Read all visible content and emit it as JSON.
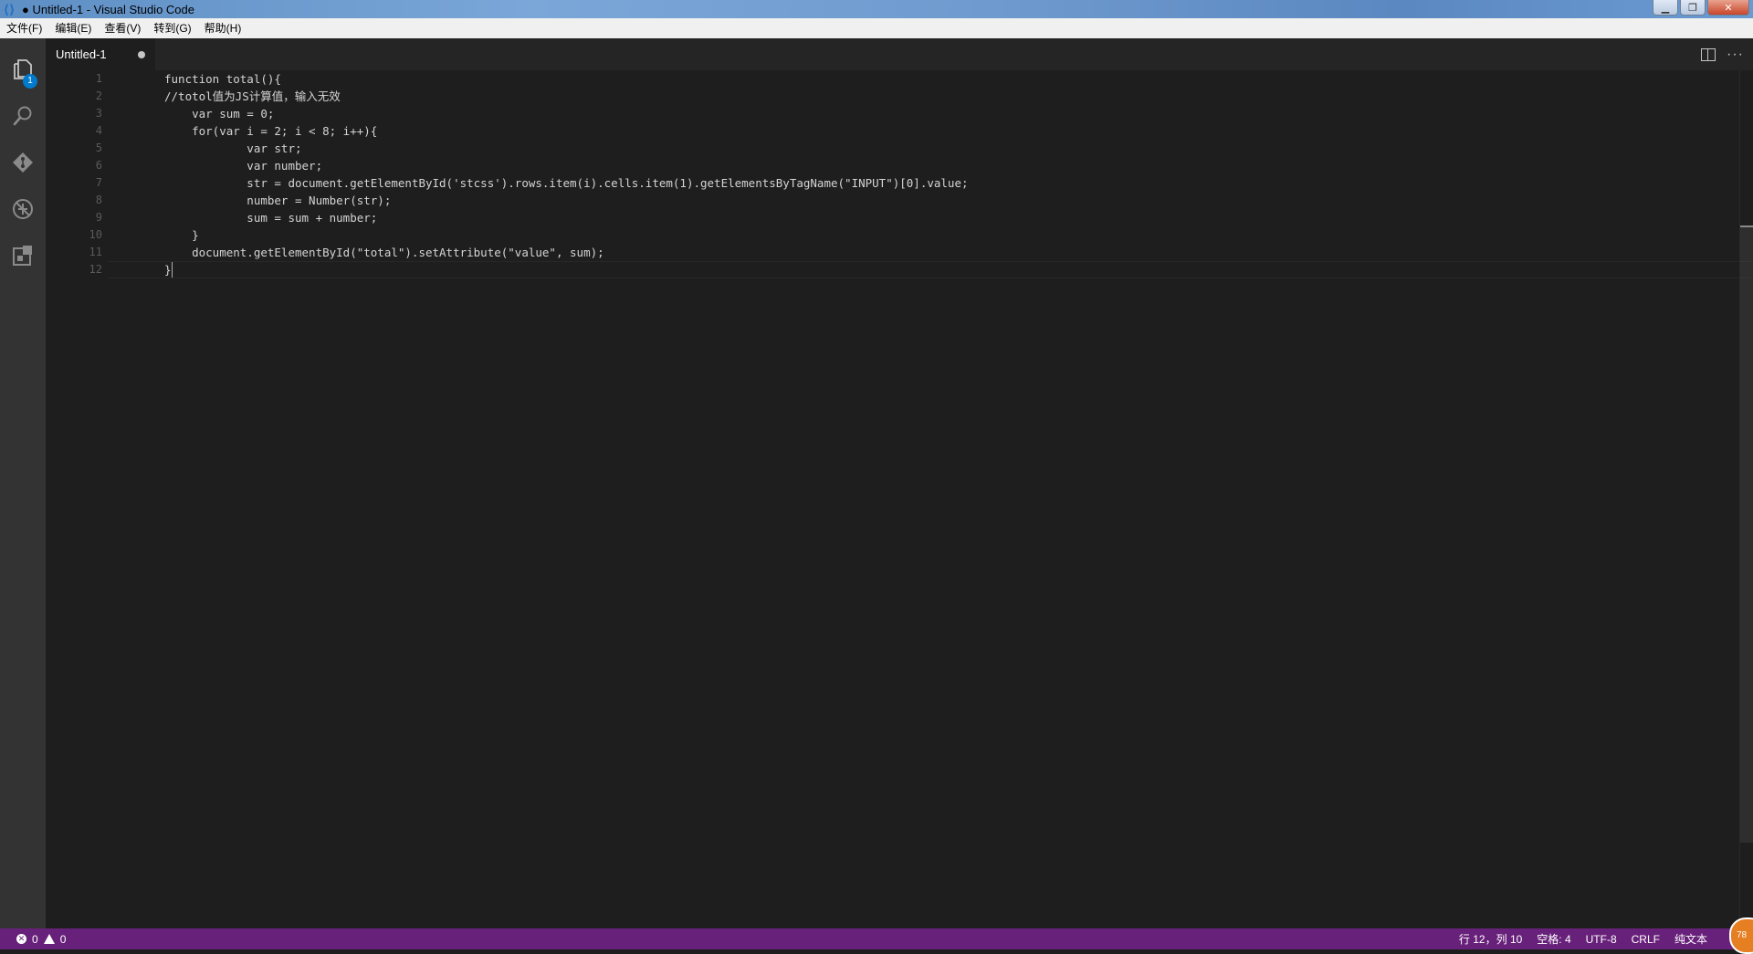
{
  "window": {
    "title": "● Untitled-1 - Visual Studio Code"
  },
  "menu": [
    "文件(F)",
    "编辑(E)",
    "查看(V)",
    "转到(G)",
    "帮助(H)"
  ],
  "activity_bar": {
    "explorer_badge": "1"
  },
  "tab": {
    "label": "Untitled-1"
  },
  "editor": {
    "lines": [
      {
        "num": "1",
        "text": "function total(){"
      },
      {
        "num": "2",
        "text": "//totol值为JS计算值，输入无效"
      },
      {
        "num": "3",
        "text": "    var sum = 0;"
      },
      {
        "num": "4",
        "text": "    for(var i = 2; i < 8; i++){"
      },
      {
        "num": "5",
        "text": "            var str;"
      },
      {
        "num": "6",
        "text": "            var number;"
      },
      {
        "num": "7",
        "text": "            str = document.getElementById('stcss').rows.item(i).cells.item(1).getElementsByTagName(\"INPUT\")[0].value;"
      },
      {
        "num": "8",
        "text": "            number = Number(str);"
      },
      {
        "num": "9",
        "text": "            sum = sum + number;"
      },
      {
        "num": "10",
        "text": "    }"
      },
      {
        "num": "11",
        "text": "    document.getElementById(\"total\").setAttribute(\"value\", sum);"
      },
      {
        "num": "12",
        "text": "}"
      }
    ]
  },
  "status": {
    "errors": "0",
    "warnings": "0",
    "position": "行 12，列 10",
    "indent": "空格: 4",
    "encoding": "UTF-8",
    "eol": "CRLF",
    "language": "纯文本",
    "notification_count": "78"
  }
}
